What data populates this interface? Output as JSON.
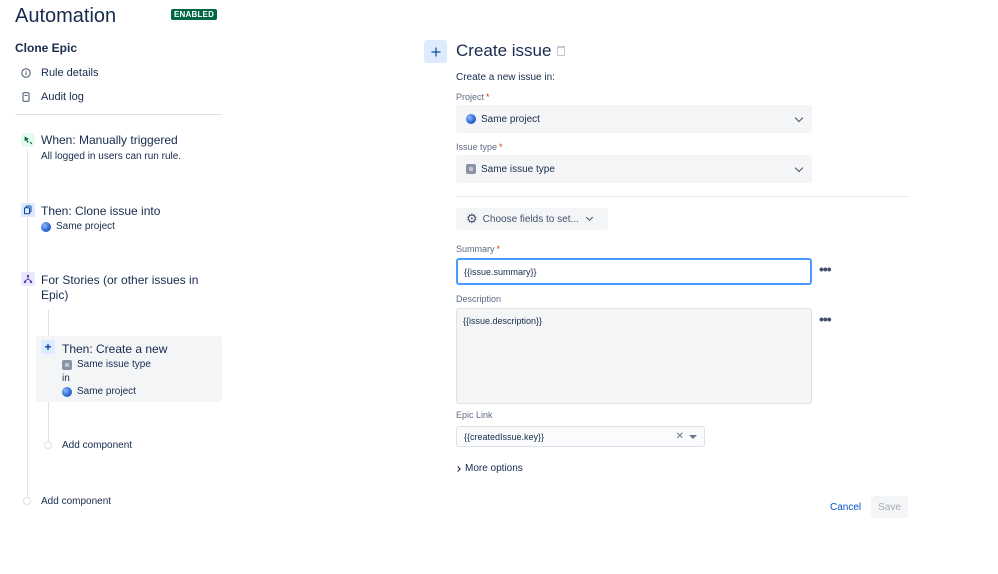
{
  "header": {
    "title": "Automation",
    "badge": "ENABLED"
  },
  "sidebar": {
    "rule_name": "Clone Epic",
    "links": [
      {
        "label": "Rule details",
        "icon": "info-icon"
      },
      {
        "label": "Audit log",
        "icon": "document-icon"
      }
    ]
  },
  "flow": {
    "trigger": {
      "title": "When: Manually triggered",
      "sub": "All logged in users can run rule.",
      "icon": "cursor-icon"
    },
    "clone": {
      "title": "Then: Clone issue into",
      "sub": "Same project",
      "icon": "copy-icon"
    },
    "branch": {
      "title_line1": "For Stories (or other issues in",
      "title_line2": "Epic)",
      "icon": "branch-icon"
    },
    "create": {
      "title": "Then: Create a new",
      "type": "Same issue type",
      "in": "in",
      "project": "Same project",
      "icon": "plus-icon"
    },
    "add_inner": "Add component",
    "add_outer": "Add component"
  },
  "panel": {
    "title": "Create issue",
    "intro": "Create a new issue in:",
    "project_label": "Project",
    "project_value": "Same project",
    "issue_type_label": "Issue type",
    "issue_type_value": "Same issue type",
    "choose_fields": "Choose fields to set...",
    "summary_label": "Summary",
    "summary_value": "{{issue.summary}}",
    "description_label": "Description",
    "description_value": "{{issue.description}}",
    "epic_label": "Epic Link",
    "epic_value": "{{createdIssue.key}}",
    "more_options": "More options",
    "cancel": "Cancel",
    "save": "Save",
    "required_mark": "*",
    "ellipsis": "•••"
  },
  "colors": {
    "badge_bg": "#006644",
    "accent": "#0052cc",
    "focus_border": "#4c9aff",
    "required": "#de350b"
  }
}
